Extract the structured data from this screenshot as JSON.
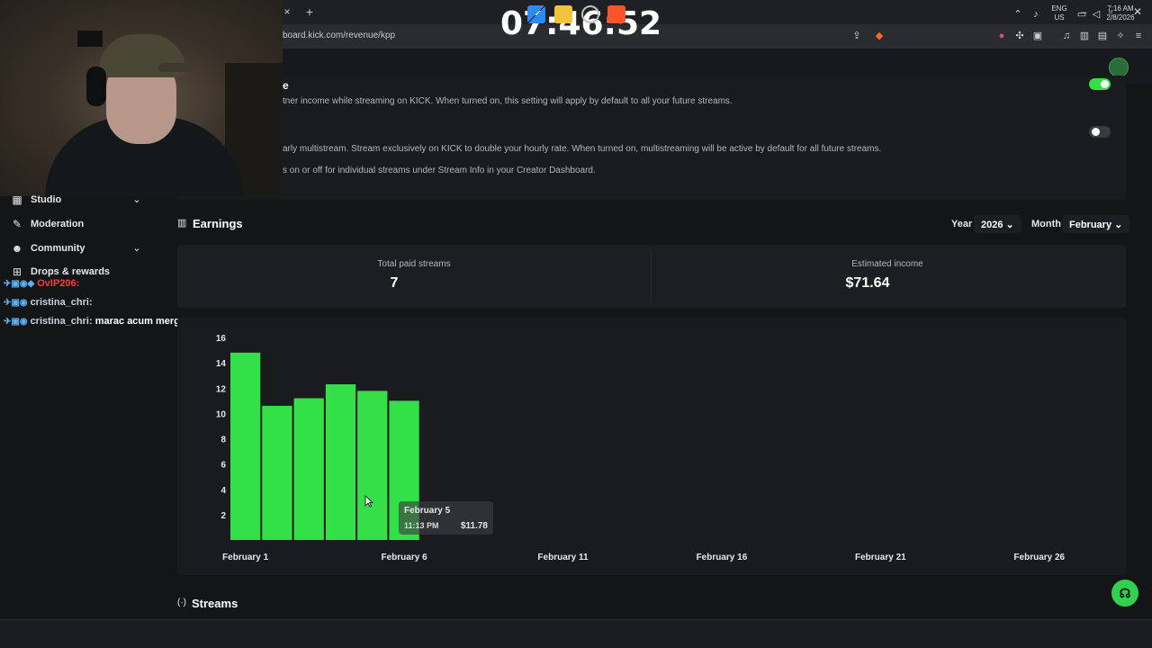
{
  "browser": {
    "tab_close": "×",
    "tab_new": "+",
    "url": "board.kick.com/revenue/kpp",
    "window_controls": [
      "–",
      "▫",
      "✕"
    ]
  },
  "overlay_clock": "07:46:52",
  "settings": {
    "title_fragment": "e",
    "line1": "tner income while streaming on KICK. When turned on, this setting will apply by default to all your future streams.",
    "line2": "arly multistream. Stream exclusively on KICK to double your hourly rate. When turned on, multistreaming will be active by default for all future streams.",
    "line3": "s on or off for individual streams under Stream Info in your Creator Dashboard.",
    "toggle1_on": true,
    "toggle2_on": false
  },
  "sidebar": {
    "items": [
      {
        "label": "Studio",
        "icon": "studio-icon",
        "has_chevron": true
      },
      {
        "label": "Moderation",
        "icon": "wrench-icon",
        "has_chevron": false
      },
      {
        "label": "Community",
        "icon": "community-icon",
        "has_chevron": true
      },
      {
        "label": "Drops & rewards",
        "icon": "gift-icon",
        "has_chevron": false
      }
    ]
  },
  "chat": [
    {
      "user": "OvIP206:",
      "message": "",
      "user_color": "#ff3b3b"
    },
    {
      "user": "cristina_chri:",
      "message": "",
      "user_color": "#c9d3e0"
    },
    {
      "user": "cristina_chri:",
      "message": "marac acum merge",
      "user_color": "#c9d3e0"
    }
  ],
  "earnings": {
    "title": "Earnings",
    "year_label": "Year",
    "year_value": "2026",
    "month_label": "Month",
    "month_value": "February",
    "total_paid_streams_label": "Total paid streams",
    "total_paid_streams_value": "7",
    "estimated_income_label": "Estimated income",
    "estimated_income_value": "$71.64"
  },
  "chart_data": {
    "type": "bar",
    "title": "",
    "xlabel": "",
    "ylabel": "",
    "ylim": [
      0,
      16
    ],
    "yticks": [
      2,
      4,
      6,
      8,
      10,
      12,
      14,
      16
    ],
    "x_tick_labels": [
      "February 1",
      "February 6",
      "February 11",
      "February 16",
      "February 21",
      "February 26"
    ],
    "x_tick_days": [
      1,
      6,
      11,
      16,
      21,
      26
    ],
    "days_in_month": 28,
    "bar_days": [
      1,
      2,
      3,
      4,
      5,
      6
    ],
    "values": [
      14.8,
      10.6,
      11.2,
      12.3,
      11.78,
      11.0
    ],
    "bar_color": "#34e048"
  },
  "tooltip": {
    "date": "February 5",
    "time": "11:13 PM",
    "value": "$11.78"
  },
  "streams": {
    "icon_text": "(·)",
    "title": "Streams"
  },
  "support_icon": "☊",
  "taskbar": {
    "lang_line1": "ENG",
    "lang_line2": "US",
    "time": "7:16 AM",
    "date": "2/8/2026"
  },
  "colors": {
    "accent_green": "#34e048",
    "page_bg": "#141517",
    "card_bg": "#1d1e21"
  }
}
